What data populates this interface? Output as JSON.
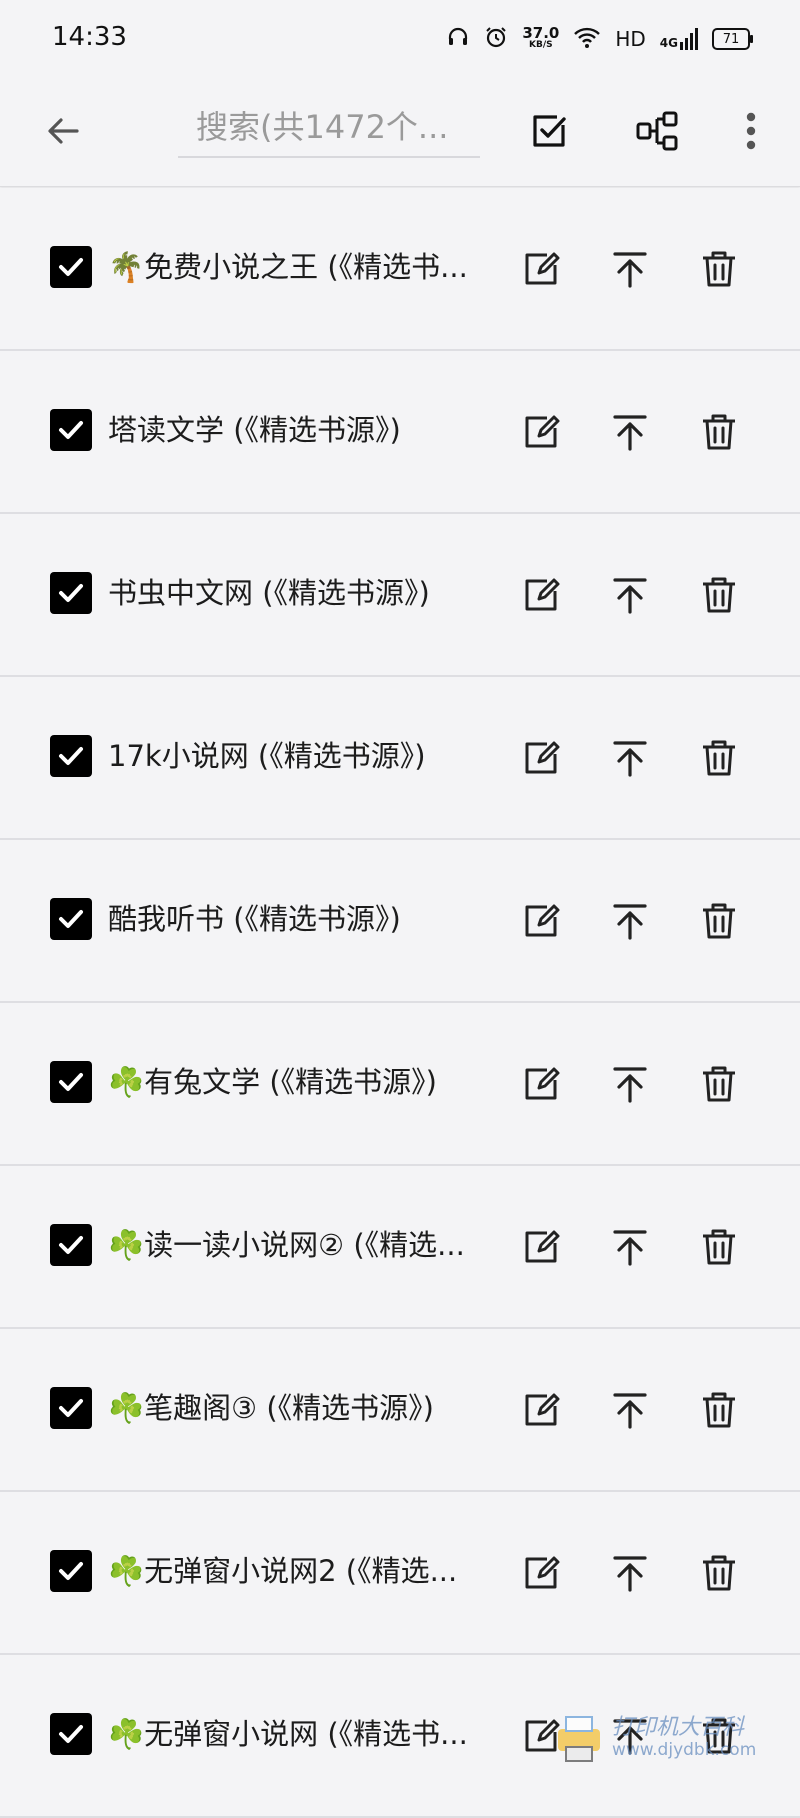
{
  "status": {
    "time": "14:33",
    "net_speed": "37.0",
    "net_unit": "KB/S",
    "hd": "HD",
    "network": "4G",
    "battery": "71"
  },
  "toolbar": {
    "back_icon": "arrow-left-icon",
    "search_placeholder": "搜索(共1472个...",
    "select_icon": "checkbox-edit-icon",
    "group_icon": "tree-icon",
    "more_icon": "more-vert-icon"
  },
  "sources": [
    {
      "title": "🌴免费小说之王 (《精选书...",
      "checked": true
    },
    {
      "title": "塔读文学 (《精选书源》)",
      "checked": true
    },
    {
      "title": "书虫中文网 (《精选书源》)",
      "checked": true
    },
    {
      "title": "17k小说网 (《精选书源》)",
      "checked": true
    },
    {
      "title": "酷我听书 (《精选书源》)",
      "checked": true
    },
    {
      "title": "☘️有兔文学 (《精选书源》)",
      "checked": true
    },
    {
      "title": "☘️读一读小说网② (《精选...",
      "checked": true
    },
    {
      "title": "☘️笔趣阁③ (《精选书源》)",
      "checked": true
    },
    {
      "title": "☘️无弹窗小说网2 (《精选...",
      "checked": true
    },
    {
      "title": "☘️无弹窗小说网 (《精选书...",
      "checked": true
    }
  ],
  "watermark": {
    "title": "打印机大百科",
    "url": "www.djydbk.com"
  }
}
